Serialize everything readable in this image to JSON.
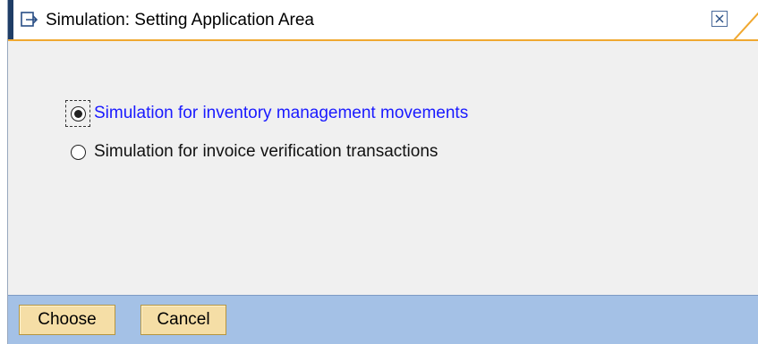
{
  "window": {
    "title": "Simulation: Setting Application Area",
    "title_icon": "dialog-icon",
    "close_icon": "close-icon"
  },
  "options": [
    {
      "label": "Simulation for inventory management movements",
      "selected": true,
      "focused": true
    },
    {
      "label": "Simulation for invoice verification transactions",
      "selected": false,
      "focused": false
    }
  ],
  "footer": {
    "choose_label": "Choose",
    "cancel_label": "Cancel"
  },
  "colors": {
    "title_border": "#f0a830",
    "footer_bg": "#a4c1e6",
    "button_bg": "#f5dea6",
    "selected_text": "#1a1aff"
  }
}
